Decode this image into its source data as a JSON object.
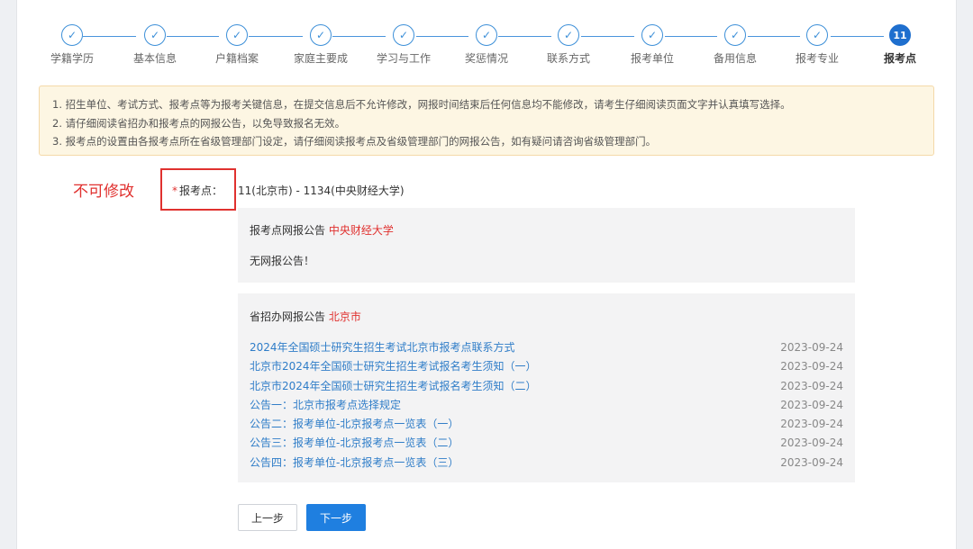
{
  "steps": [
    {
      "label": "学籍学历",
      "icon": "check-icon"
    },
    {
      "label": "基本信息",
      "icon": "check-icon"
    },
    {
      "label": "户籍档案",
      "icon": "check-icon"
    },
    {
      "label": "家庭主要成",
      "icon": "check-icon"
    },
    {
      "label": "学习与工作",
      "icon": "check-icon"
    },
    {
      "label": "奖惩情况",
      "icon": "check-icon"
    },
    {
      "label": "联系方式",
      "icon": "check-icon"
    },
    {
      "label": "报考单位",
      "icon": "check-icon"
    },
    {
      "label": "备用信息",
      "icon": "check-icon"
    },
    {
      "label": "报考专业",
      "icon": "check-icon"
    },
    {
      "label": "报考点",
      "number": "11"
    }
  ],
  "notice": [
    "1. 招生单位、考试方式、报考点等为报考关键信息，在提交信息后不允许修改，网报时间结束后任何信息均不能修改，请考生仔细阅读页面文字并认真填写选择。",
    "2. 请仔细阅读省招办和报考点的网报公告，以免导致报名无效。",
    "3. 报考点的设置由各报考点所在省级管理部门设定，请仔细阅读报考点及省级管理部门的网报公告，如有疑问请咨询省级管理部门。"
  ],
  "annotation": "不可修改",
  "field": {
    "star": "*",
    "label": "报考点：",
    "value": "11(北京市) - 1134(中央财经大学)"
  },
  "point_notice": {
    "title": "报考点网报公告",
    "name": "中央财经大学",
    "message": "无网报公告！"
  },
  "province_notice": {
    "title": "省招办网报公告",
    "name": "北京市",
    "items": [
      {
        "text": "2024年全国硕士研究生招生考试北京市报考点联系方式",
        "date": "2023-09-24"
      },
      {
        "text": "北京市2024年全国硕士研究生招生考试报名考生须知（一）",
        "date": "2023-09-24"
      },
      {
        "text": "北京市2024年全国硕士研究生招生考试报名考生须知（二）",
        "date": "2023-09-24"
      },
      {
        "text": "公告一：北京市报考点选择规定",
        "date": "2023-09-24"
      },
      {
        "text": "公告二：报考单位-北京报考点一览表（一）",
        "date": "2023-09-24"
      },
      {
        "text": "公告三：报考单位-北京报考点一览表（二）",
        "date": "2023-09-24"
      },
      {
        "text": "公告四：报考单位-北京报考点一览表（三）",
        "date": "2023-09-24"
      }
    ]
  },
  "buttons": {
    "prev": "上一步",
    "next": "下一步"
  },
  "colors": {
    "primary": "#1f7fe0",
    "step_line": "#4a94dc",
    "alert": "#e0312f",
    "notice_bg": "#fdf6e3",
    "link": "#2f7dc8"
  }
}
